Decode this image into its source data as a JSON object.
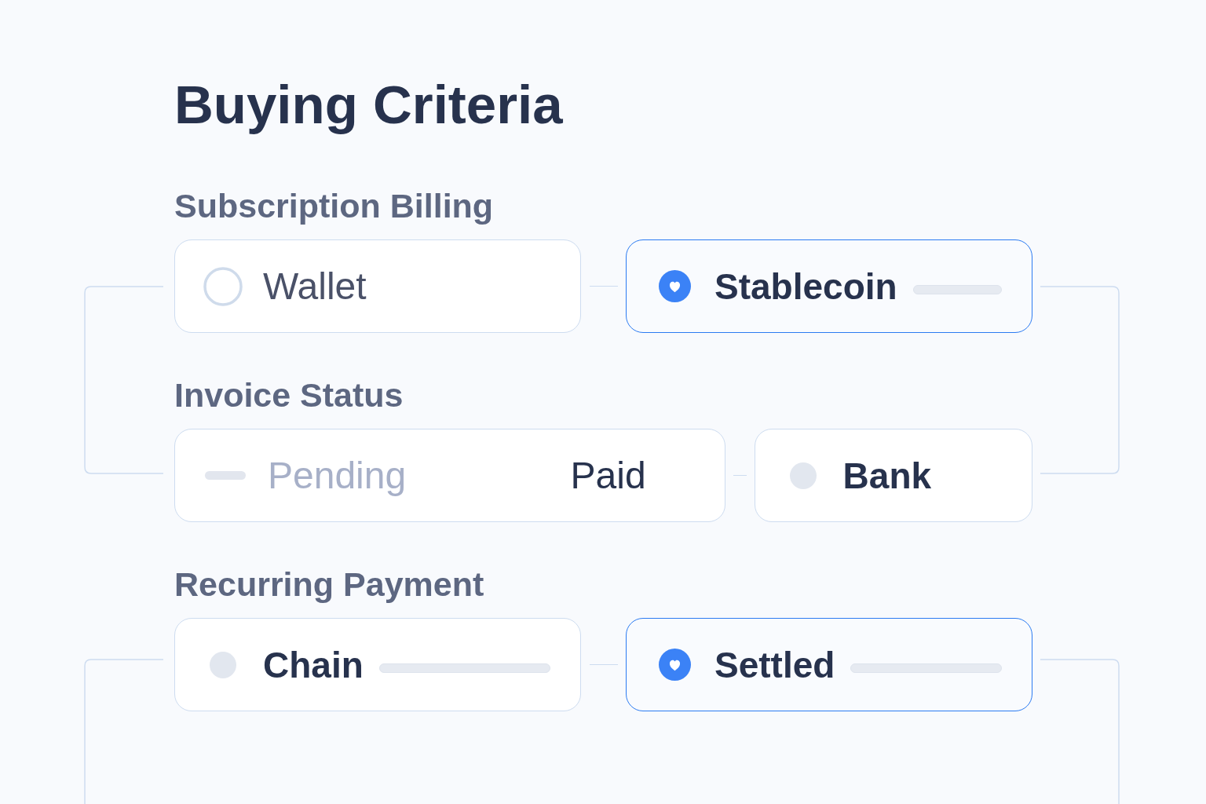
{
  "title": "Buying Criteria",
  "sections": [
    {
      "label": "Subscription Billing",
      "options": [
        {
          "kind": "radio",
          "label": "Wallet",
          "selected": false,
          "placeholder_bar": false
        },
        {
          "kind": "dot",
          "label": "Stablecoin",
          "selected": true,
          "placeholder_bar": true
        }
      ]
    },
    {
      "label": "Invoice Status",
      "options": [
        {
          "kind": "segmented",
          "segments": [
            {
              "label": "Pending",
              "selected": false
            },
            {
              "label": "Paid",
              "selected": true
            }
          ]
        },
        {
          "kind": "dot",
          "label": "Bank",
          "selected": false,
          "placeholder_bar": false
        }
      ]
    },
    {
      "label": "Recurring Payment",
      "options": [
        {
          "kind": "dot",
          "label": "Chain",
          "selected": false,
          "placeholder_bar": true
        },
        {
          "kind": "dot",
          "label": "Settled",
          "selected": true,
          "placeholder_bar": true
        }
      ]
    }
  ]
}
